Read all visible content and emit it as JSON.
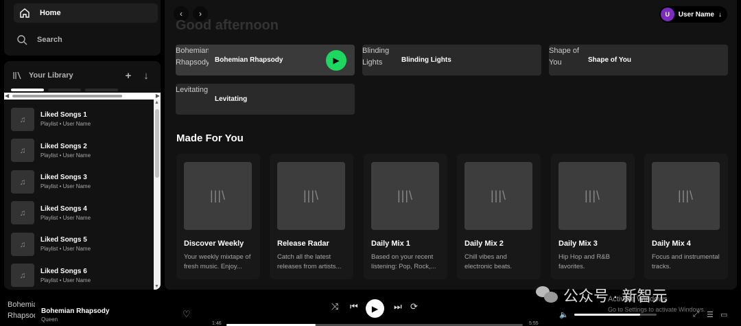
{
  "nav": {
    "home": "Home",
    "search": "Search"
  },
  "library": {
    "title": "Your Library",
    "add_icon": "plus-icon",
    "expand_icon": "arrow-down-icon",
    "items": [
      {
        "name": "Liked Songs 1",
        "sub": "Playlist • User Name"
      },
      {
        "name": "Liked Songs 2",
        "sub": "Playlist • User Name"
      },
      {
        "name": "Liked Songs 3",
        "sub": "Playlist • User Name"
      },
      {
        "name": "Liked Songs 4",
        "sub": "Playlist • User Name"
      },
      {
        "name": "Liked Songs 5",
        "sub": "Playlist • User Name"
      },
      {
        "name": "Liked Songs 6",
        "sub": "Playlist • User Name"
      }
    ]
  },
  "header": {
    "greeting": "Good afternoon",
    "user": {
      "initial": "U",
      "name": "User Name"
    }
  },
  "quick_picks": [
    {
      "label": "Bohemian Rhapsody",
      "img_alt": "Bohemian Rhapsody",
      "active": true
    },
    {
      "label": "Blinding Lights",
      "img_alt": "Blinding Lights"
    },
    {
      "label": "Shape of You",
      "img_alt": "Shape of You"
    },
    {
      "label": "Levitating",
      "img_alt": "Levitating"
    }
  ],
  "made_for_you": {
    "title": "Made For You",
    "cards": [
      {
        "title": "Discover Weekly",
        "desc": "Your weekly mixtape of fresh music. Enjoy..."
      },
      {
        "title": "Release Radar",
        "desc": "Catch all the latest releases from artists..."
      },
      {
        "title": "Daily Mix 1",
        "desc": "Based on your recent listening: Pop, Rock,..."
      },
      {
        "title": "Daily Mix 2",
        "desc": "Chill vibes and electronic beats."
      },
      {
        "title": "Daily Mix 3",
        "desc": "Hip Hop and R&B favorites."
      },
      {
        "title": "Daily Mix 4",
        "desc": "Focus and instrumental tracks."
      }
    ]
  },
  "player": {
    "track": "Bohemian Rhapsody",
    "artist": "Queen",
    "img_alt": "Bohemian Rhapsody",
    "elapsed": "1:46",
    "duration": "5:55",
    "progress_fraction": 0.3,
    "volume_fraction": 0.8
  },
  "overlay": {
    "watermark": "公众号 · 新智元",
    "activate_title": "Activate Windows",
    "activate_sub": "Go to Settings to activate Windows."
  },
  "colors": {
    "accent": "#1ed760",
    "avatar": "#7b2cbf",
    "background": "#121212"
  }
}
